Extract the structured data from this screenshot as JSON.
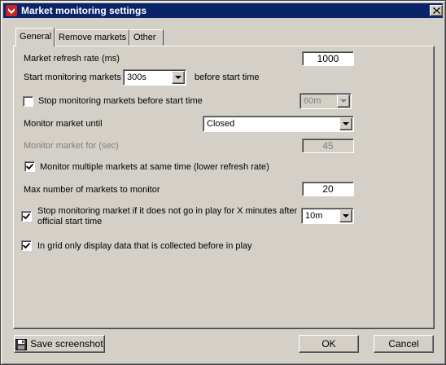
{
  "window": {
    "title": "Market monitoring settings"
  },
  "tabs": [
    {
      "label": "General"
    },
    {
      "label": "Remove markets"
    },
    {
      "label": "Other"
    }
  ],
  "general": {
    "refresh_rate": {
      "label": "Market refresh rate (ms)",
      "value": "1000"
    },
    "start_monitoring": {
      "label": "Start monitoring markets",
      "value": "300s",
      "suffix": "before start time"
    },
    "stop_before_start": {
      "label": "Stop monitoring markets before start time",
      "checked": false,
      "value": "60m"
    },
    "monitor_until": {
      "label": "Monitor market until",
      "value": "Closed"
    },
    "monitor_for": {
      "label": "Monitor market for (sec)",
      "value": "45"
    },
    "multiple_markets": {
      "label": "Monitor multiple markets at same time (lower refresh rate)",
      "checked": true
    },
    "max_markets": {
      "label": "Max number of markets to monitor",
      "value": "20"
    },
    "stop_not_in_play": {
      "label_line1": "Stop monitoring market if it does not go in play for X minutes after",
      "label_line2": "official start time",
      "checked": true,
      "value": "10m"
    },
    "grid_only_before": {
      "label": "In grid only display data that is collected before in play",
      "checked": true
    }
  },
  "footer": {
    "save_screenshot": "Save screenshot",
    "ok": "OK",
    "cancel": "Cancel"
  }
}
